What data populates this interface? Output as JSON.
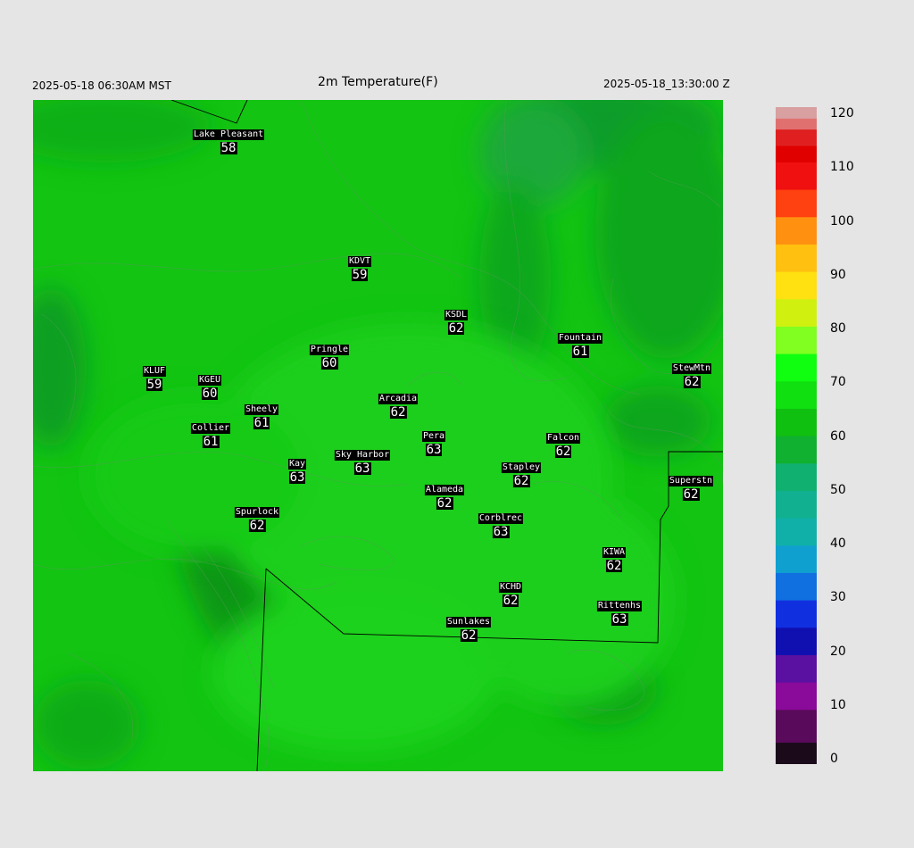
{
  "header": {
    "local_time": "2025-05-18 06:30AM MST",
    "title": "2m Temperature(F)",
    "utc_time": "2025-05-18_13:30:00 Z"
  },
  "colors": {
    "background": "#e5e5e5",
    "map_base_green": "#12c812",
    "map_dark_green": "#0aa00a",
    "map_light_green": "#20d820",
    "boundary_line": "#000000"
  },
  "stations": [
    {
      "name": "Lake Pleasant",
      "value": "58"
    },
    {
      "name": "KDVT",
      "value": "59"
    },
    {
      "name": "KSDL",
      "value": "62"
    },
    {
      "name": "Fountain",
      "value": "61"
    },
    {
      "name": "StewMtn",
      "value": "62"
    },
    {
      "name": "Pringle",
      "value": "60"
    },
    {
      "name": "KLUF",
      "value": "59"
    },
    {
      "name": "KGEU",
      "value": "60"
    },
    {
      "name": "Arcadia",
      "value": "62"
    },
    {
      "name": "Sheely",
      "value": "61"
    },
    {
      "name": "Collier",
      "value": "61"
    },
    {
      "name": "Pera",
      "value": "63"
    },
    {
      "name": "Falcon",
      "value": "62"
    },
    {
      "name": "Kay",
      "value": "63"
    },
    {
      "name": "Sky Harbor",
      "value": "63"
    },
    {
      "name": "Stapley",
      "value": "62"
    },
    {
      "name": "Superstn",
      "value": "62"
    },
    {
      "name": "Alameda",
      "value": "62"
    },
    {
      "name": "Spurlock",
      "value": "62"
    },
    {
      "name": "Corblrec",
      "value": "63"
    },
    {
      "name": "KIWA",
      "value": "62"
    },
    {
      "name": "KCHD",
      "value": "62"
    },
    {
      "name": "Rittenhs",
      "value": "63"
    },
    {
      "name": "Sunlakes",
      "value": "62"
    }
  ],
  "colorbar": {
    "min": 0,
    "max": 120,
    "ticks": [
      "120",
      "110",
      "100",
      "90",
      "80",
      "70",
      "60",
      "50",
      "40",
      "30",
      "20",
      "10",
      "0"
    ]
  }
}
